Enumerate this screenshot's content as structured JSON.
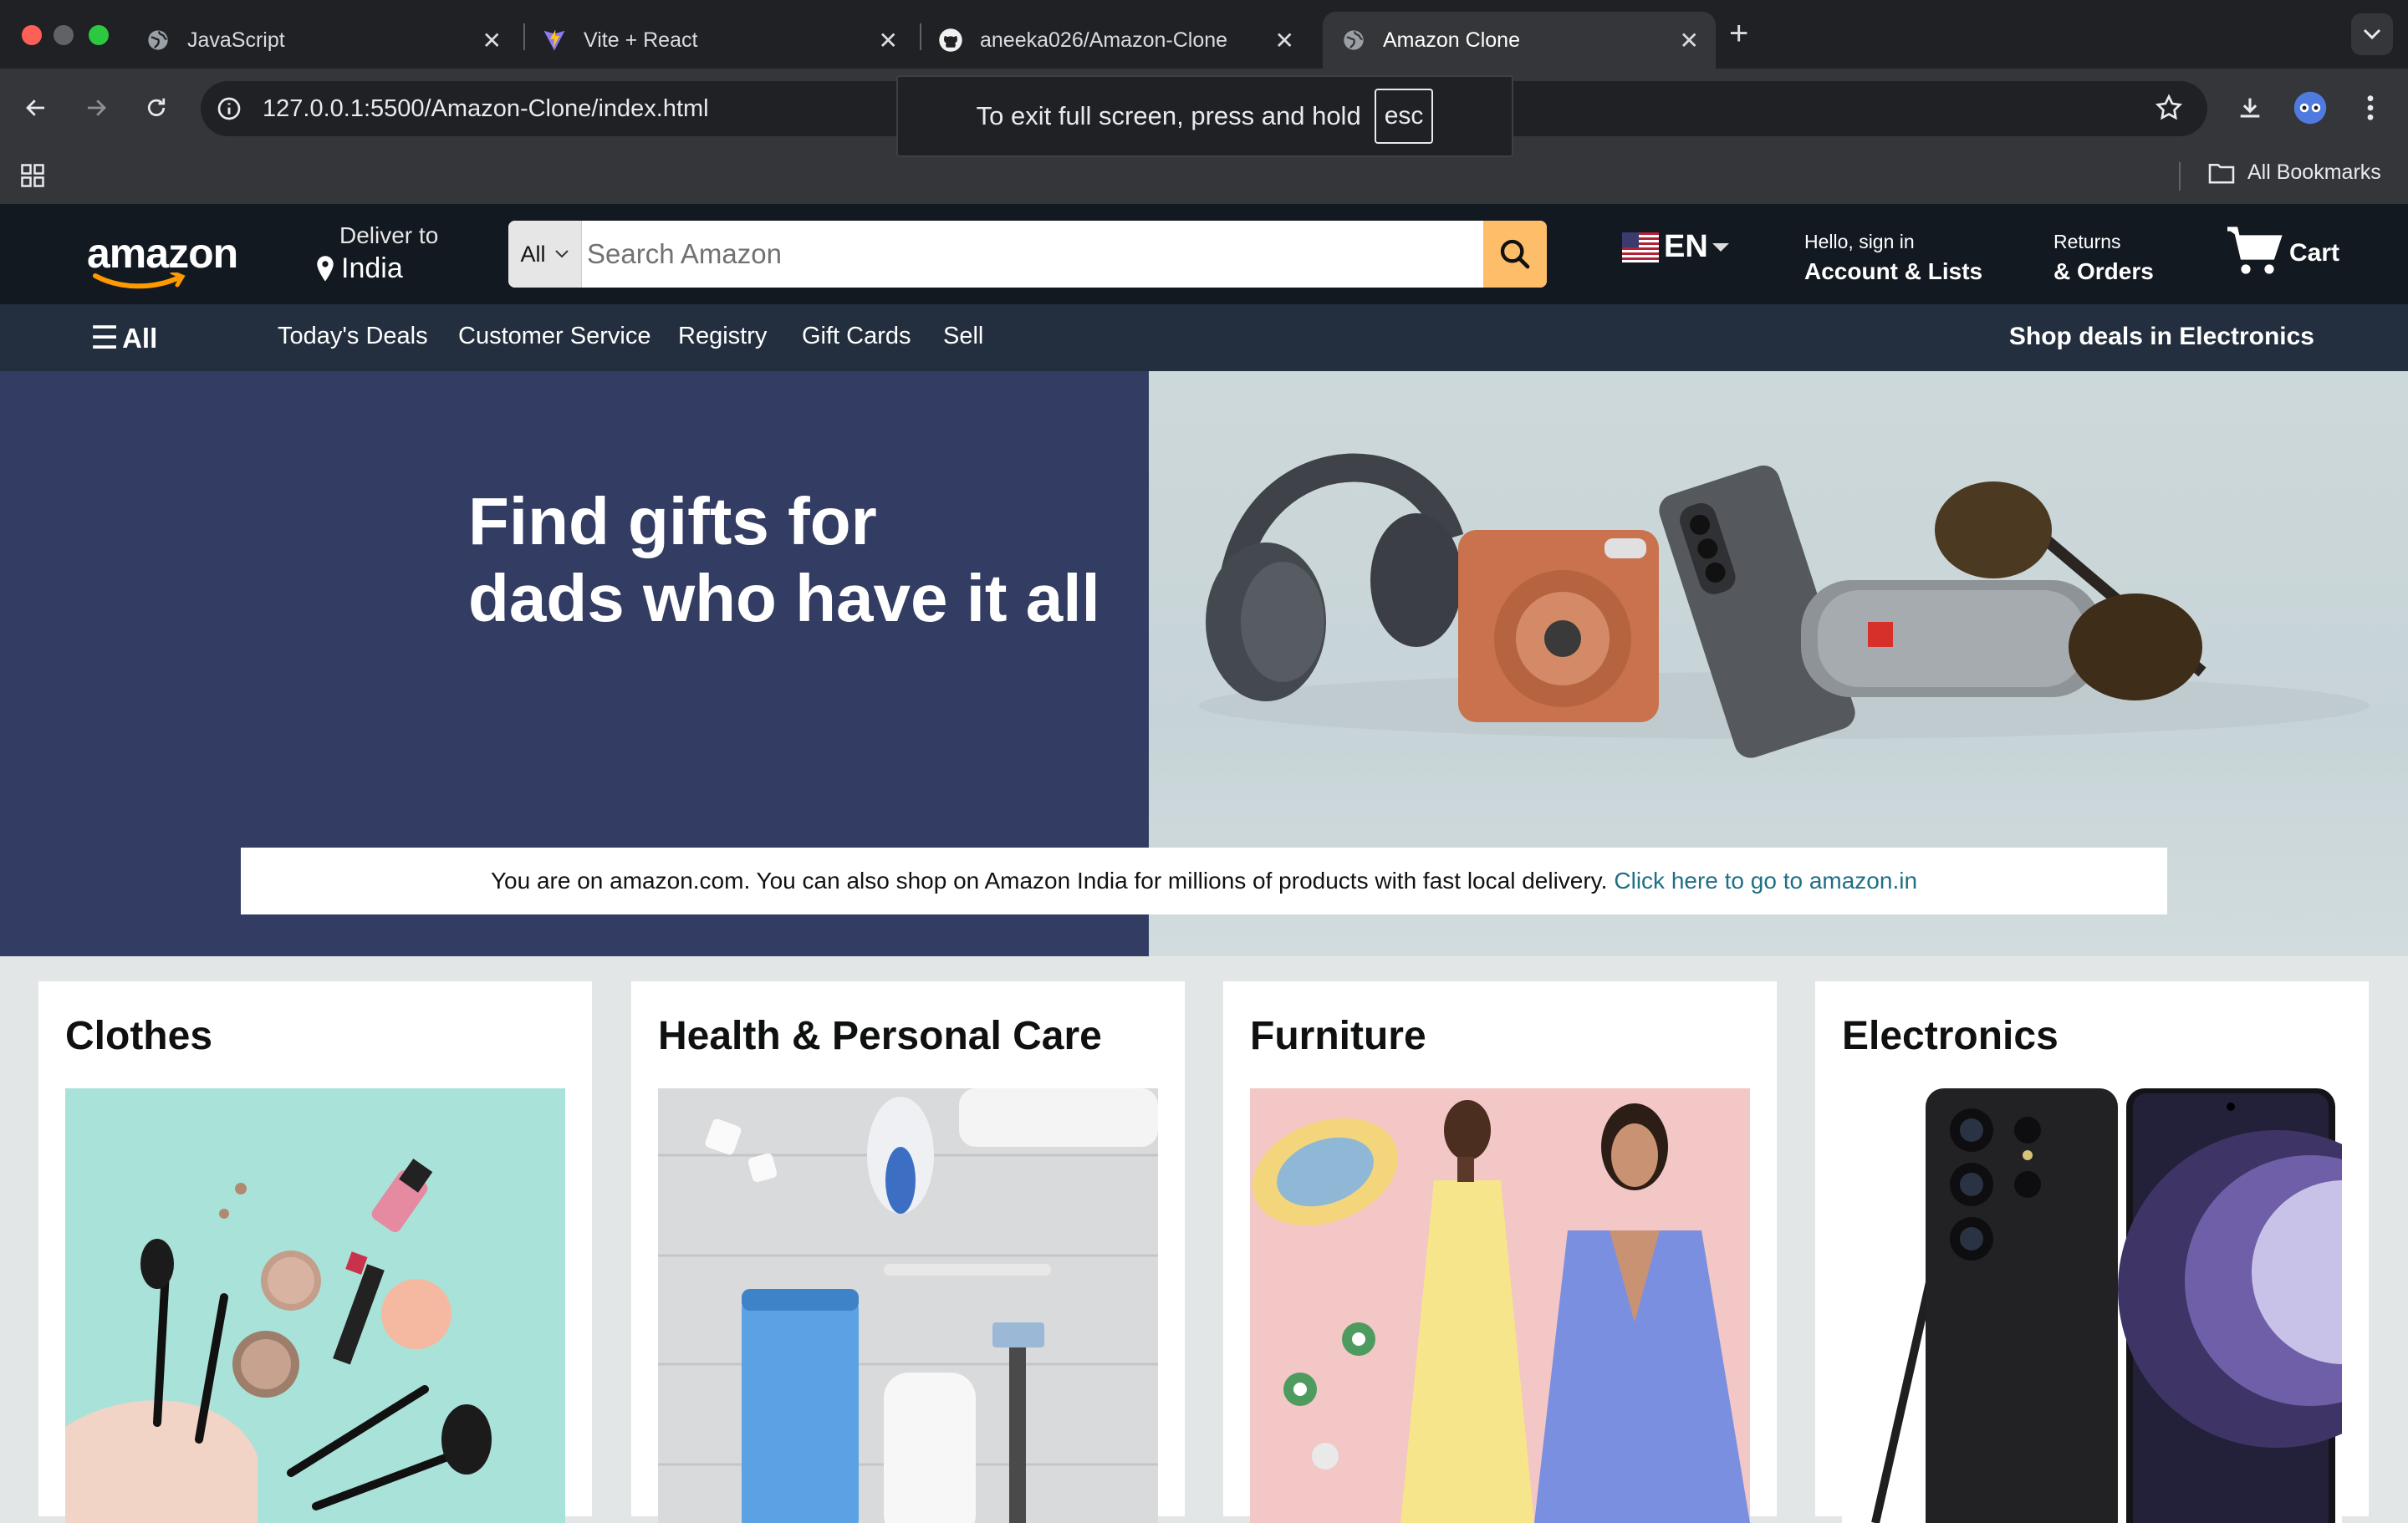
{
  "browser": {
    "tabs": [
      {
        "title": "JavaScript",
        "icon": "globe-icon"
      },
      {
        "title": "Vite + React",
        "icon": "vite-icon"
      },
      {
        "title": "aneeka026/Amazon-Clone",
        "icon": "github-icon"
      },
      {
        "title": "Amazon Clone",
        "icon": "globe-icon",
        "active": true
      }
    ],
    "url": "127.0.0.1:5500/Amazon-Clone/index.html",
    "fullscreen_toast": {
      "text": "To exit full screen, press and hold",
      "key": "esc"
    },
    "bookmarks_label": "All Bookmarks"
  },
  "header": {
    "logo_text": "amazon",
    "deliver_line1": "Deliver to",
    "deliver_line2": "India",
    "search_category": "All",
    "search_placeholder": "Search Amazon",
    "language": "EN",
    "account_line1": "Hello, sign in",
    "account_line2": "Account & Lists",
    "orders_line1": "Returns",
    "orders_line2": "& Orders",
    "cart_label": "Cart"
  },
  "subnav": {
    "all_label": "All",
    "links": [
      "Today's Deals",
      "Customer Service",
      "Registry",
      "Gift Cards",
      "Sell"
    ],
    "deals_label": "Shop deals in Electronics"
  },
  "hero": {
    "headline_line1": "Find gifts for",
    "headline_line2": "dads who have it all",
    "notice_text": "You are on amazon.com. You can also shop on Amazon India for millions of products with fast local delivery.",
    "notice_link": "Click here to go to amazon.in"
  },
  "cards": [
    {
      "title": "Clothes"
    },
    {
      "title": "Health & Personal Care"
    },
    {
      "title": "Furniture"
    },
    {
      "title": "Electronics"
    }
  ],
  "colors": {
    "amazon_nav": "#131921",
    "amazon_subnav": "#232f3e",
    "search_button": "#febd69",
    "hero_left": "#333d63",
    "link": "#1f6f86"
  }
}
